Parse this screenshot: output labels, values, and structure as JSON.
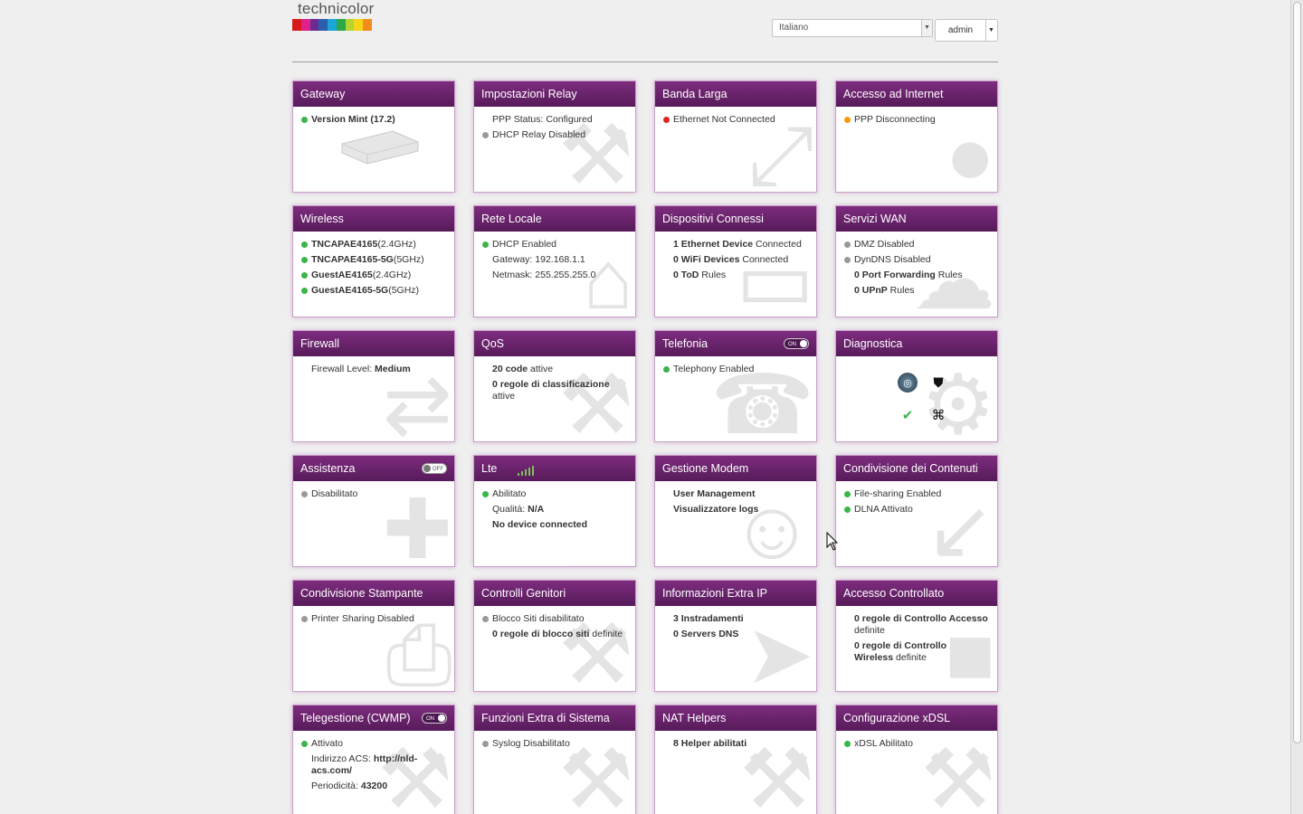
{
  "header": {
    "brand": "technicolor",
    "brand_colors": [
      "#d7191c",
      "#e0218a",
      "#6a2c91",
      "#2b5fae",
      "#1ba7d6",
      "#2aa84a",
      "#b6d334",
      "#f7d417",
      "#f28c1e"
    ],
    "language": "Italiano",
    "user": "admin"
  },
  "cards": [
    {
      "title": "Gateway",
      "lines": [
        {
          "dot": "green",
          "bold": "Version Mint (17.2)"
        }
      ],
      "icon": "gateway-device-image"
    },
    {
      "title": "Impostazioni Relay",
      "lines": [
        {
          "text": "PPP Status: Configured"
        },
        {
          "dot": "gray",
          "text": "DHCP Relay Disabled"
        }
      ],
      "icon": "wrench-icon"
    },
    {
      "title": "Banda Larga",
      "lines": [
        {
          "dot": "red",
          "text": "Ethernet Not Connected"
        }
      ],
      "icon": "expand-arrows-icon"
    },
    {
      "title": "Accesso ad Internet",
      "lines": [
        {
          "dot": "orange",
          "text": "PPP Disconnecting"
        }
      ],
      "icon": "globe-icon"
    },
    {
      "title": "Wireless",
      "lines": [
        {
          "dot": "green",
          "bold": "TNCAPAE4165",
          "text": "(2.4GHz)"
        },
        {
          "dot": "green",
          "bold": "TNCAPAE4165-5G",
          "text": "(5GHz)"
        },
        {
          "dot": "green",
          "bold": "GuestAE4165",
          "text": "(2.4GHz)"
        },
        {
          "dot": "green",
          "bold": "GuestAE4165-5G",
          "text": "(5GHz)"
        }
      ],
      "icon": "wifi-icon"
    },
    {
      "title": "Rete Locale",
      "lines": [
        {
          "dot": "green",
          "text": "DHCP Enabled"
        },
        {
          "text": "Gateway: 192.168.1.1"
        },
        {
          "text": "Netmask: 255.255.255.0"
        }
      ],
      "icon": "home-icon"
    },
    {
      "title": "Dispositivi Connessi",
      "lines": [
        {
          "bold": "1 Ethernet Device",
          "text": " Connected"
        },
        {
          "bold": "0 WiFi Devices",
          "text": " Connected"
        },
        {
          "bold": "0 ToD",
          "text": " Rules"
        }
      ],
      "icon": "monitor-icon"
    },
    {
      "title": "Servizi WAN",
      "lines": [
        {
          "dot": "gray",
          "text": "DMZ Disabled"
        },
        {
          "dot": "gray",
          "text": "DynDNS Disabled"
        },
        {
          "bold": "0 Port Forwarding",
          "text": " Rules"
        },
        {
          "bold": "0 UPnP",
          "text": " Rules"
        }
      ],
      "icon": "cloud-icon"
    },
    {
      "title": "Firewall",
      "lines": [
        {
          "text": "Firewall Level: ",
          "bold_after": "Medium"
        }
      ],
      "icon": "shuffle-icon"
    },
    {
      "title": "QoS",
      "lines": [
        {
          "bold": "20 code",
          "text": " attive"
        },
        {
          "bold": "0 regole di classificazione",
          "text": " attive"
        }
      ],
      "icon": "wrench-icon"
    },
    {
      "title": "Telefonia",
      "toggle": "ON",
      "lines": [
        {
          "dot": "green",
          "text": "Telephony Enabled"
        }
      ],
      "icon": "phone-icon"
    },
    {
      "title": "Diagnostica",
      "lines": [],
      "icon": "gear-icon",
      "diag": true
    },
    {
      "title": "Assistenza",
      "toggle": "OFF",
      "lines": [
        {
          "dot": "gray",
          "text": "Disabilitato"
        }
      ],
      "icon": "plus-icon"
    },
    {
      "title": "Lte",
      "signal": true,
      "lines": [
        {
          "dot": "green",
          "text": "Abilitato"
        },
        {
          "text": "Qualità: ",
          "bold_after": "N/A"
        },
        {
          "bold": "No device connected"
        }
      ],
      "icon": "bars-icon"
    },
    {
      "title": "Gestione Modem",
      "lines": [
        {
          "bold": "User Management"
        },
        {
          "bold": "Visualizzatore logs"
        }
      ],
      "icon": "users-icon"
    },
    {
      "title": "Condivisione dei Contenuti",
      "lines": [
        {
          "dot": "green",
          "text": "File-sharing Enabled"
        },
        {
          "dot": "green",
          "text": "DLNA Attivato"
        }
      ],
      "icon": "arrow-in-icon"
    },
    {
      "title": "Condivisione Stampante",
      "lines": [
        {
          "dot": "gray",
          "text": "Printer Sharing Disabled"
        }
      ],
      "icon": "printer-icon"
    },
    {
      "title": "Controlli Genitori",
      "lines": [
        {
          "dot": "gray",
          "text": "Blocco Siti disabilitato"
        },
        {
          "bold": "0 regole di blocco siti",
          "text": " definite"
        }
      ],
      "icon": "wrench-icon"
    },
    {
      "title": "Informazioni Extra IP",
      "lines": [
        {
          "bold": "3 Instradamenti"
        },
        {
          "bold": "0 Servers DNS"
        }
      ],
      "icon": "paper-plane-icon"
    },
    {
      "title": "Accesso Controllato",
      "lines": [
        {
          "bold": "0 regole di Controllo Accesso",
          "text": " definite"
        },
        {
          "bold": "0 regole di Controllo Wireless",
          "text": " definite"
        }
      ],
      "icon": "lock-icon"
    },
    {
      "title": "Telegestione (CWMP)",
      "toggle": "ON",
      "lines": [
        {
          "dot": "green",
          "text": "Attivato"
        },
        {
          "text": "Indirizzo ACS: ",
          "bold_after": "http://nld-acs.com/"
        },
        {
          "text": "Periodicità: ",
          "bold_after": "43200"
        }
      ],
      "icon": "wrench-icon"
    },
    {
      "title": "Funzioni Extra di Sistema",
      "lines": [
        {
          "dot": "gray",
          "text": "Syslog Disabilitato"
        }
      ],
      "icon": "wrench-icon"
    },
    {
      "title": "NAT Helpers",
      "lines": [
        {
          "bold": "8 Helper abilitati"
        }
      ],
      "icon": "wrench-icon"
    },
    {
      "title": "Configurazione xDSL",
      "lines": [
        {
          "dot": "green",
          "text": "xDSL Abilitato"
        }
      ],
      "icon": "wrench-icon"
    }
  ],
  "watermarks": {
    "gateway-device-image": "",
    "wrench-icon": "⚒",
    "expand-arrows-icon": "⤢",
    "globe-icon": "●",
    "wifi-icon": "",
    "home-icon": "⌂",
    "monitor-icon": "▭",
    "cloud-icon": "☁",
    "shuffle-icon": "⇄",
    "phone-icon": "☎",
    "gear-icon": "⚙",
    "plus-icon": "✚",
    "bars-icon": "▁",
    "users-icon": "☺",
    "arrow-in-icon": "↙",
    "printer-icon": "⎙",
    "paper-plane-icon": "➤",
    "lock-icon": "■"
  }
}
